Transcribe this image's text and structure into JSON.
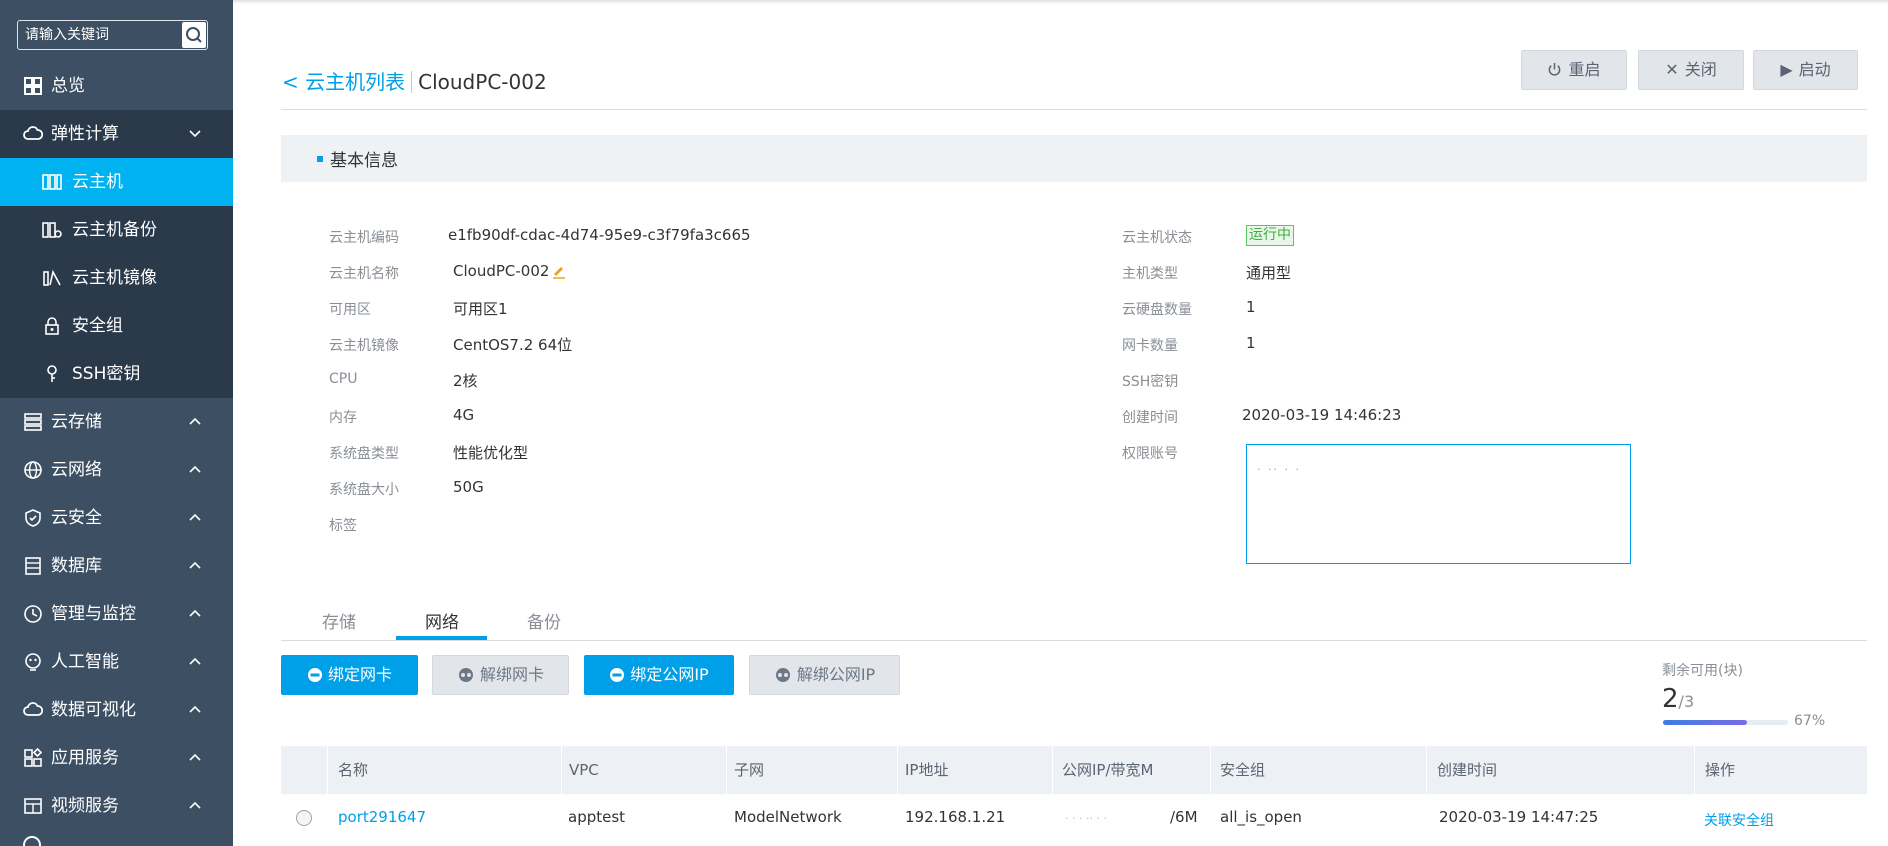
{
  "sidebar": {
    "search_placeholder": "请输入关键词",
    "items": [
      {
        "label": "总览",
        "icon": "grid-icon"
      },
      {
        "label": "弹性计算",
        "icon": "cloud-icon",
        "expanded": true
      },
      {
        "label": "云存储",
        "icon": "storage-icon"
      },
      {
        "label": "云网络",
        "icon": "globe-icon"
      },
      {
        "label": "云安全",
        "icon": "shield-icon"
      },
      {
        "label": "数据库",
        "icon": "database-icon"
      },
      {
        "label": "管理与监控",
        "icon": "monitor-icon"
      },
      {
        "label": "人工智能",
        "icon": "ai-icon"
      },
      {
        "label": "数据可视化",
        "icon": "cloud-icon"
      },
      {
        "label": "应用服务",
        "icon": "apps-icon"
      },
      {
        "label": "视频服务",
        "icon": "video-icon"
      }
    ],
    "sub_items": [
      {
        "label": "云主机",
        "icon": "server-icon",
        "active": true
      },
      {
        "label": "云主机备份",
        "icon": "backup-icon"
      },
      {
        "label": "云主机镜像",
        "icon": "image-icon"
      },
      {
        "label": "安全组",
        "icon": "lock-icon"
      },
      {
        "label": "SSH密钥",
        "icon": "key-icon"
      }
    ],
    "active_color": "#00b2ef",
    "bg_color": "#3d4f63"
  },
  "header": {
    "back_label": "< 云主机列表",
    "instance_name": "CloudPC-002",
    "buttons": {
      "restart": "重启",
      "shutdown": "关闭",
      "start": "启动"
    }
  },
  "basic_info": {
    "title": "基本信息",
    "left": [
      {
        "label": "云主机编码",
        "value": "e1fb90df-cdac-4d74-95e9-c3f79fa3c665"
      },
      {
        "label": "云主机名称",
        "value": "CloudPC-002"
      },
      {
        "label": "可用区",
        "value": "可用区1"
      },
      {
        "label": "云主机镜像",
        "value": "CentOS7.2 64位"
      },
      {
        "label": "CPU",
        "value": "2核"
      },
      {
        "label": "内存",
        "value": "4G"
      },
      {
        "label": "系统盘类型",
        "value": "性能优化型"
      },
      {
        "label": "系统盘大小",
        "value": "50G"
      },
      {
        "label": "标签",
        "value": ""
      }
    ],
    "right": [
      {
        "label": "云主机状态",
        "value": "运行中"
      },
      {
        "label": "主机类型",
        "value": "通用型"
      },
      {
        "label": "云硬盘数量",
        "value": "1"
      },
      {
        "label": "网卡数量",
        "value": "1"
      },
      {
        "label": "SSH密钥",
        "value": ""
      },
      {
        "label": "创建时间",
        "value": "2020-03-19 14:46:23"
      },
      {
        "label": "权限账号",
        "value": ""
      }
    ],
    "status_color": "#3cb03c"
  },
  "tabs": [
    {
      "label": "存储"
    },
    {
      "label": "网络",
      "active": true
    },
    {
      "label": "备份"
    }
  ],
  "actions": {
    "bind_nic": "绑定网卡",
    "unbind_nic": "解绑网卡",
    "bind_public_ip": "绑定公网IP",
    "unbind_public_ip": "解绑公网IP"
  },
  "quota": {
    "label": "剩余可用(块)",
    "used": "2",
    "total": "/3",
    "percent_text": "67%",
    "fraction": 0.67
  },
  "table": {
    "columns": [
      "名称",
      "VPC",
      "子网",
      "IP地址",
      "公网IP/带宽M",
      "安全组",
      "创建时间",
      "操作"
    ],
    "rows": [
      {
        "name": "port291647",
        "vpc": "apptest",
        "subnet": "ModelNetwork",
        "ip": "192.168.1.21",
        "public_ip": "/6M",
        "security_group": "all_is_open",
        "created": "2020-03-19 14:47:25",
        "action": "关联安全组"
      }
    ]
  }
}
